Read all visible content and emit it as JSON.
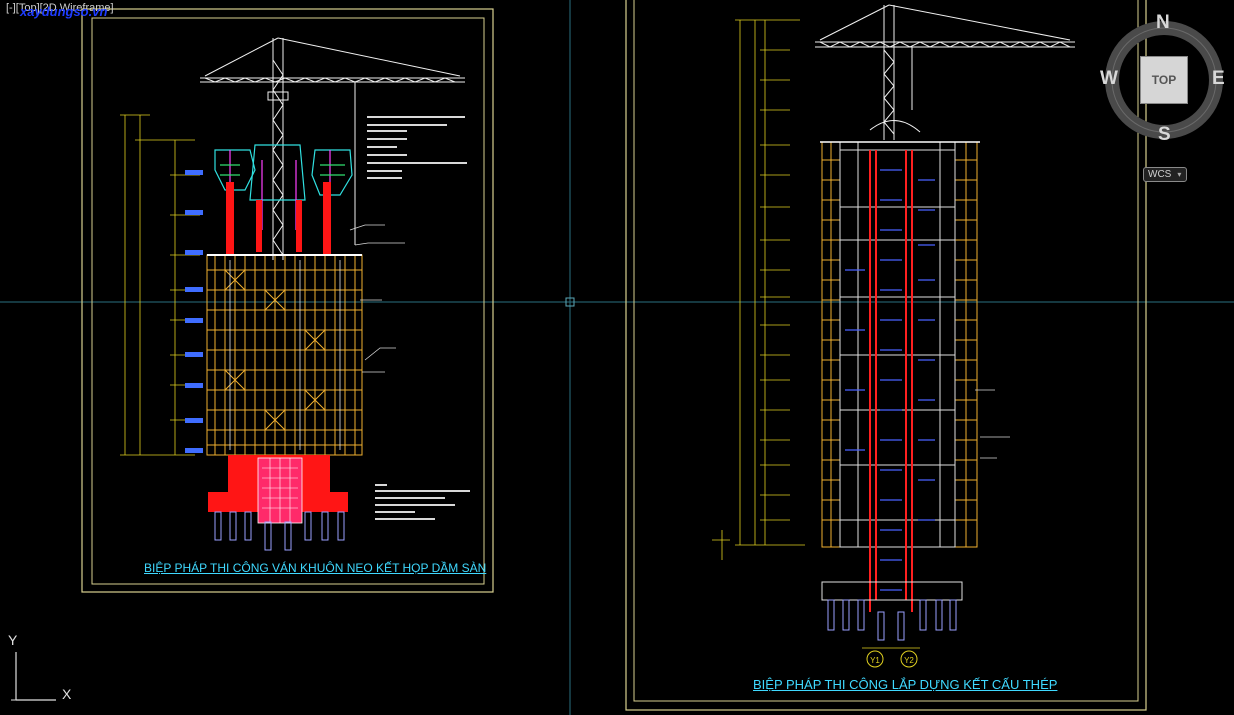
{
  "viewport": {
    "label": "[-][Top][2D Wireframe]",
    "watermark": "xaydungso.vn"
  },
  "sheets": [
    {
      "title": "BIỆP PHÁP THI CÔNG VÁN KHUÔN NEO KẾT HỌP DẦM SÀN"
    },
    {
      "title": "BIỆP PHÁP THI CÔNG LẮP DỰNG KẾT CẤU THÉP"
    }
  ],
  "viewcube": {
    "north": "N",
    "south": "S",
    "east": "E",
    "west": "W",
    "face": "TOP",
    "icon": "viewcube-compass-icon"
  },
  "coordinate_system": {
    "label": "WCS",
    "icon": "chevron-down-icon"
  },
  "ucs_icon": {
    "x_label": "X",
    "y_label": "Y",
    "icon": "ucs-axis-icon"
  },
  "grid_labels": [
    "Y1",
    "Y2"
  ],
  "colors": {
    "background": "#000000",
    "sheet_border": "#e8e0a0",
    "crosshair": "#2c7a8c",
    "scaffold": "#f0b030",
    "core_red": "#ff1010",
    "title_text": "#3fd9ff",
    "dimension": "#e0d020"
  }
}
